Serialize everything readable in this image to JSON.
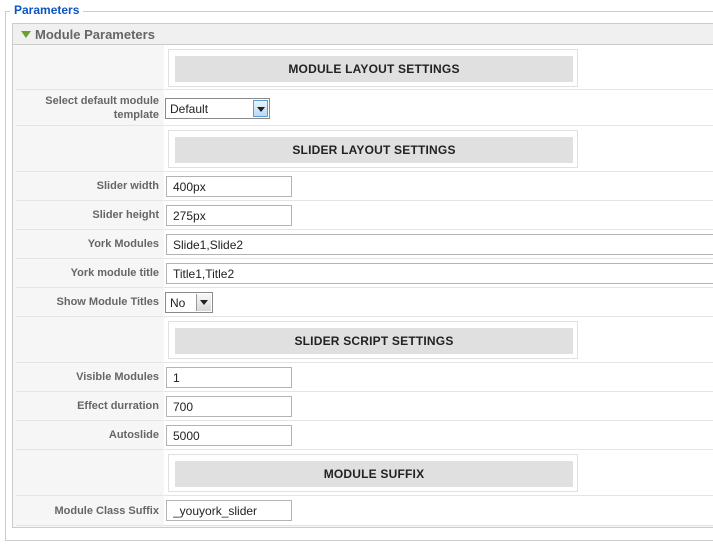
{
  "fieldset": {
    "legend": "Parameters"
  },
  "panel": {
    "title": "Module Parameters"
  },
  "sections": {
    "module_layout": "MODULE LAYOUT SETTINGS",
    "slider_layout": "SLIDER LAYOUT SETTINGS",
    "slider_script": "SLIDER SCRIPT SETTINGS",
    "module_suffix": "MODULE SUFFIX"
  },
  "fields": {
    "template": {
      "label": "Select default module template",
      "value": "Default"
    },
    "slider_width": {
      "label": "Slider width",
      "value": "400px"
    },
    "slider_height": {
      "label": "Slider height",
      "value": "275px"
    },
    "york_modules": {
      "label": "York Modules",
      "value": "Slide1,Slide2"
    },
    "york_module_title": {
      "label": "York module title",
      "value": "Title1,Title2"
    },
    "show_module_titles": {
      "label": "Show Module Titles",
      "value": "No"
    },
    "visible_modules": {
      "label": "Visible Modules",
      "value": "1"
    },
    "effect_durration": {
      "label": "Effect durration",
      "value": "700"
    },
    "autoslide": {
      "label": "Autoslide",
      "value": "5000"
    },
    "module_class_suffix": {
      "label": "Module Class Suffix",
      "value": "_youyork_slider"
    }
  }
}
